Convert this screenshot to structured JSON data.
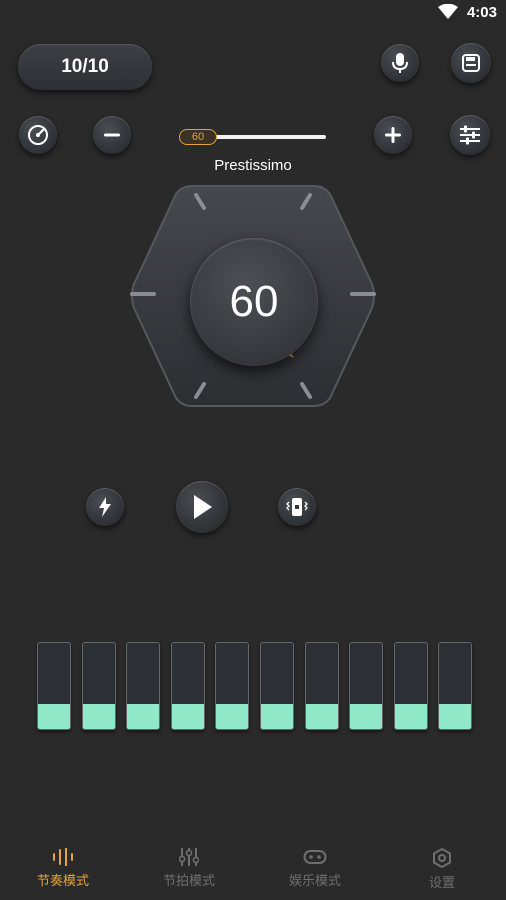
{
  "status": {
    "time": "4:03"
  },
  "counter": {
    "label": "10/10"
  },
  "slider": {
    "value_label": "60"
  },
  "tempo": {
    "marking": "Prestissimo",
    "bpm": "60"
  },
  "beat_bars": {
    "count": 10,
    "levels": [
      0.28,
      0.28,
      0.28,
      0.28,
      0.28,
      0.28,
      0.28,
      0.28,
      0.28,
      0.28
    ]
  },
  "nav": {
    "items": [
      {
        "label": "节奏模式",
        "icon": "rhythm-icon",
        "active": true
      },
      {
        "label": "节拍模式",
        "icon": "sliders-icon",
        "active": false
      },
      {
        "label": "娱乐模式",
        "icon": "gamepad-icon",
        "active": false
      },
      {
        "label": "设置",
        "icon": "settings-hex-icon",
        "active": false
      }
    ]
  },
  "colors": {
    "accent": "#e8a23a",
    "bar_fill": "#8fe8c8",
    "background": "#2a2a2a",
    "inactive": "#6f6f6f"
  }
}
